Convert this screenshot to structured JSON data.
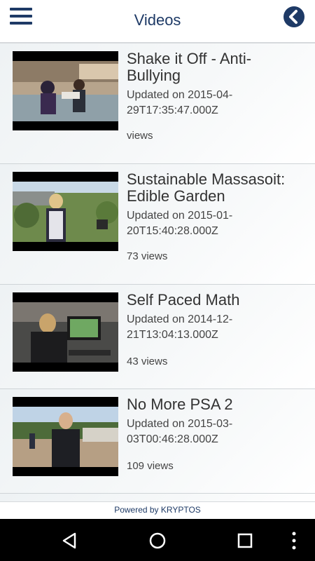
{
  "header": {
    "title": "Videos"
  },
  "videos": [
    {
      "title": "Shake it Off - Anti-Bullying",
      "updated": "Updated on 2015-04-29T17:35:47.000Z",
      "views": "views"
    },
    {
      "title": "Sustainable Massasoit: Edible Garden",
      "updated": "Updated on 2015-01-20T15:40:28.000Z",
      "views": "73 views"
    },
    {
      "title": "Self Paced Math",
      "updated": "Updated on 2014-12-21T13:04:13.000Z",
      "views": "43 views"
    },
    {
      "title": "No More PSA 2",
      "updated": "Updated on 2015-03-03T00:46:28.000Z",
      "views": "109 views"
    }
  ],
  "footer": {
    "powered_by": "Powered by KRYPTOS"
  },
  "colors": {
    "brand": "#1e3a66",
    "navbar": "#000000"
  },
  "icons": {
    "menu": "hamburger-menu-icon",
    "back": "back-chevron-icon",
    "nav_back": "nav-back-triangle-icon",
    "nav_home": "nav-home-circle-icon",
    "nav_recents": "nav-recents-square-icon",
    "nav_more": "nav-overflow-dots-icon"
  }
}
